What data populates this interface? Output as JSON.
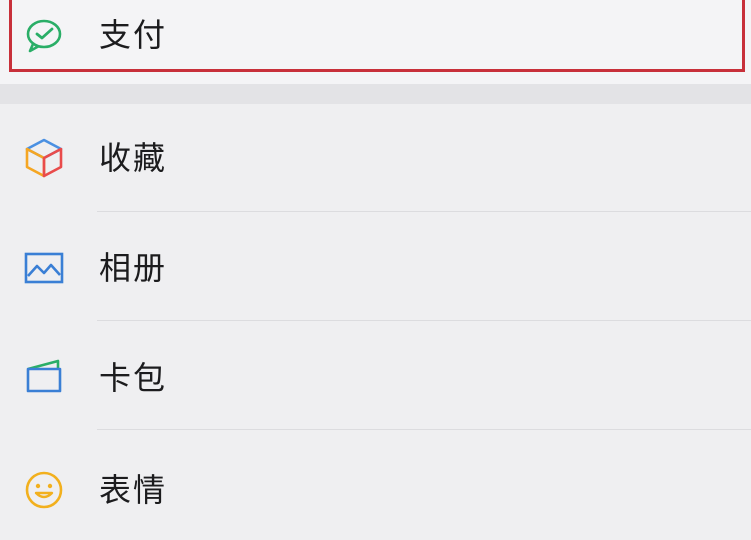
{
  "menu": {
    "pay": {
      "label": "支付",
      "icon": "wechat-pay-icon",
      "highlight_color": "#c8303a"
    },
    "favorites": {
      "label": "收藏",
      "icon": "cube-icon"
    },
    "album": {
      "label": "相册",
      "icon": "photo-icon"
    },
    "cards": {
      "label": "卡包",
      "icon": "card-wallet-icon"
    },
    "stickers": {
      "label": "表情",
      "icon": "smiley-icon"
    }
  }
}
